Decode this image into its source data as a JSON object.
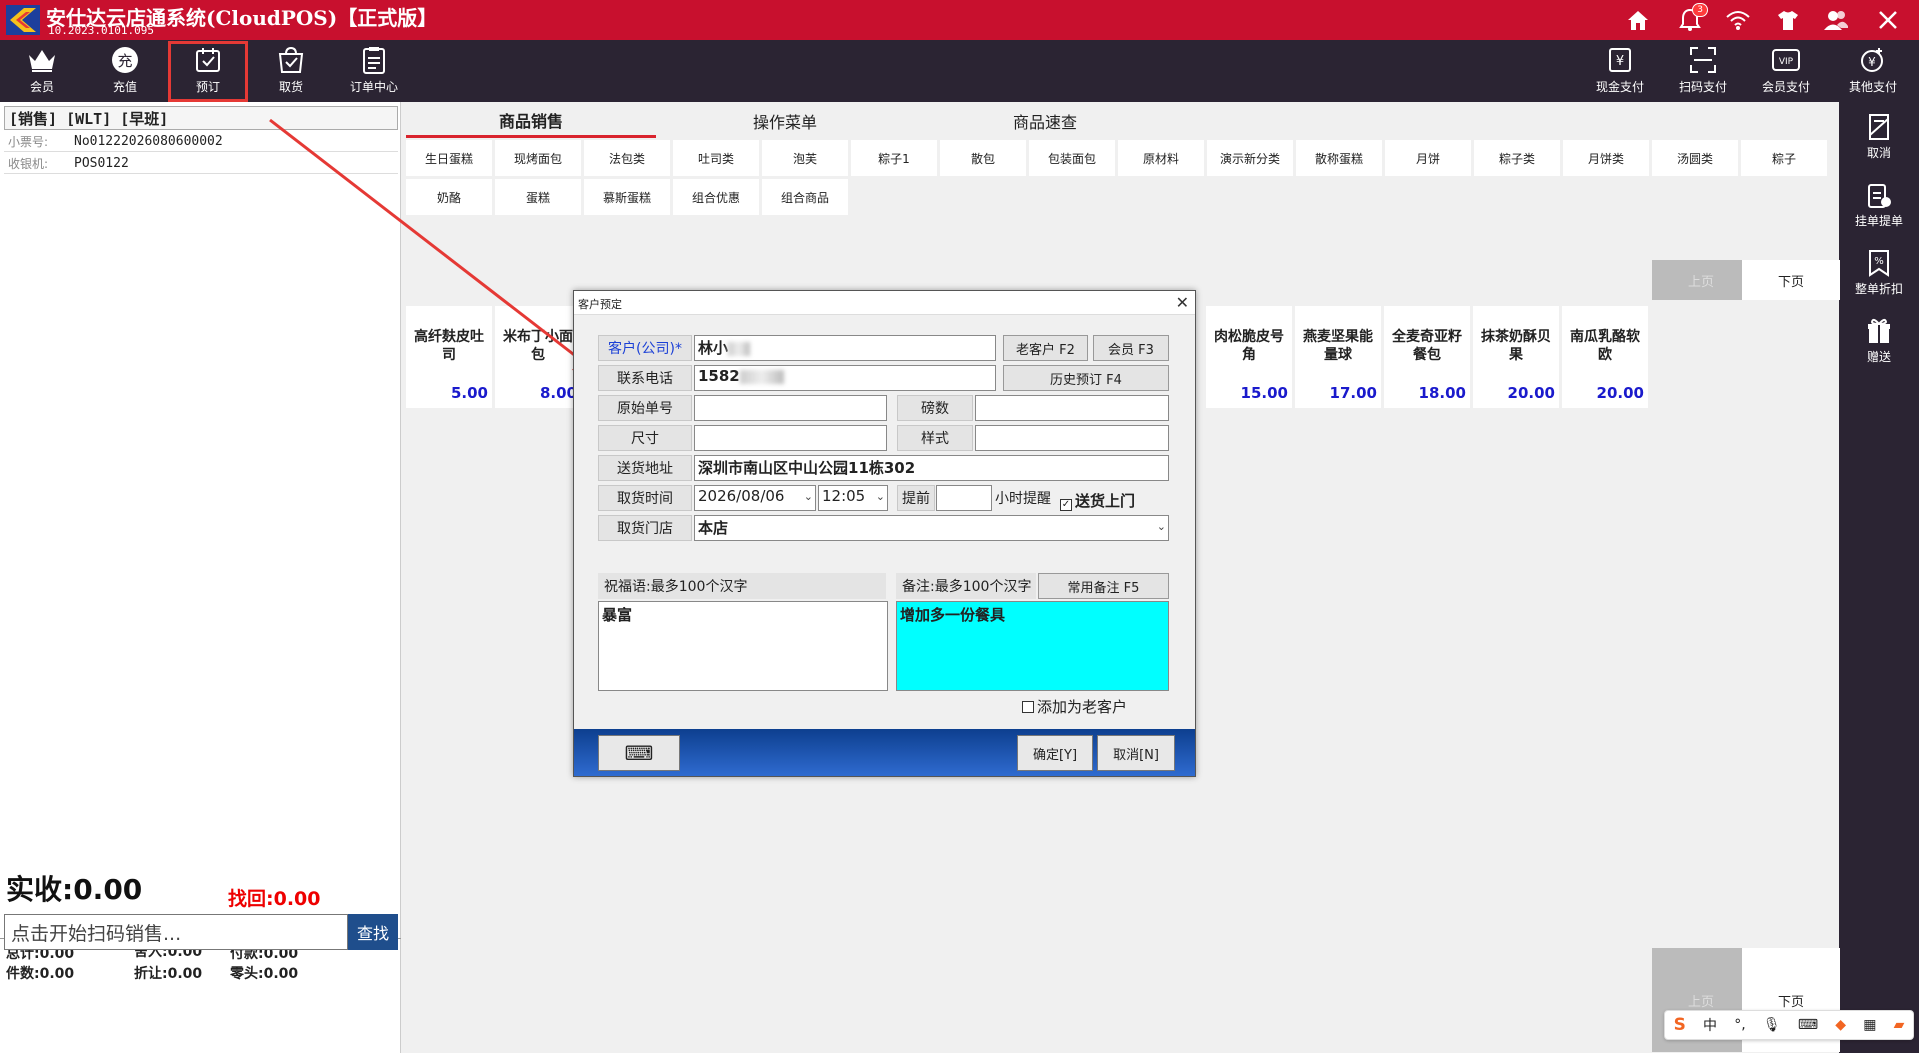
{
  "titlebar": {
    "title": "安仕达云店通系统(CloudPOS)【正式版】",
    "version": "10.2023.0101.095",
    "notification_count": "3"
  },
  "toolbar": {
    "left": [
      "会员",
      "充值",
      "预订",
      "取货",
      "订单中心"
    ],
    "right": [
      "现金支付",
      "扫码支付",
      "会员支付",
      "其他支付"
    ],
    "vip_text": "VIP"
  },
  "rsidebar": [
    "取消",
    "挂单提单",
    "整单折扣",
    "赠送"
  ],
  "left": {
    "shift": "[销售] [WLT] [早班]",
    "ticket_label": "小票号:",
    "ticket_value": "No01222026080600002",
    "cashier_label": "收银机:",
    "cashier_value": "POS0122",
    "totals": {
      "total": "总计:0.00",
      "rounding": "舍入:0.00",
      "payment": "付款:0.00",
      "count": "件数:0.00",
      "discount": "折让:0.00",
      "change_small": "零头:0.00"
    },
    "paid": "实收:0.00",
    "change": "找回:0.00",
    "scan_placeholder": "点击开始扫码销售...",
    "search": "查找"
  },
  "tabs": [
    "商品销售",
    "操作菜单",
    "商品速查"
  ],
  "categories_row1": [
    "生日蛋糕",
    "现烤面包",
    "法包类",
    "吐司类",
    "泡芙",
    "粽子1",
    "散包",
    "包装面包",
    "原材料",
    "演示新分类",
    "散称蛋糕",
    "月饼",
    "粽子类",
    "月饼类",
    "汤圆类",
    "粽子"
  ],
  "categories_row2": [
    "奶酪",
    "蛋糕",
    "慕斯蛋糕",
    "组合优惠",
    "组合商品"
  ],
  "pager": {
    "prev": "上页",
    "next": "下页"
  },
  "products": [
    {
      "name": "高纤麸皮吐司",
      "price": "5.00"
    },
    {
      "name": "米布丁小面包",
      "price": "8.00"
    },
    {
      "name": "肉松脆皮号角",
      "price": "15.00"
    },
    {
      "name": "燕麦坚果能量球",
      "price": "17.00"
    },
    {
      "name": "全麦奇亚籽餐包",
      "price": "18.00"
    },
    {
      "name": "抹茶奶酥贝果",
      "price": "20.00"
    },
    {
      "name": "南瓜乳酪软欧",
      "price": "20.00"
    }
  ],
  "dialog": {
    "title": "客户预定",
    "customer_label": "客户(公司)*",
    "customer_value": "林小",
    "old_customer_btn": "老客户 F2",
    "member_btn": "会员 F3",
    "phone_label": "联系电话",
    "phone_value": "1582",
    "history_btn": "历史预订 F4",
    "orig_no_label": "原始单号",
    "pounds_label": "磅数",
    "size_label": "尺寸",
    "style_label": "样式",
    "address_label": "送货地址",
    "address_value": "深圳市南山区中山公园11栋302",
    "pickup_time_label": "取货时间",
    "pickup_date": "2026/08/06",
    "pickup_clock": "12:05",
    "advance_label": "提前",
    "hour_remind": "小时提醒",
    "deliver_label": "送货上门",
    "store_label": "取货门店",
    "store_value": "本店",
    "blessing_label": "祝福语:最多100个汉字",
    "blessing_value": "暴富",
    "remark_label": "备注:最多100个汉字",
    "common_remark_btn": "常用备注 F5",
    "remark_value": "增加多一份餐具",
    "add_old_customer": "添加为老客户",
    "ok": "确定[Y]",
    "cancel": "取消[N]",
    "keyboard_icon": "⌨"
  },
  "ime": [
    "中",
    "°,"
  ]
}
